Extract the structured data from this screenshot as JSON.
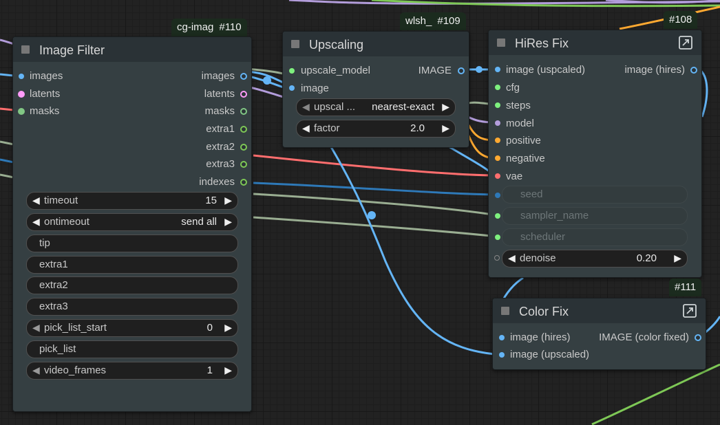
{
  "nodes": {
    "image_filter": {
      "title": "Image Filter",
      "badge_title": "cg-imag",
      "badge_id": "#110",
      "inputs": [
        "images",
        "latents",
        "masks"
      ],
      "outputs": [
        "images",
        "latents",
        "masks",
        "extra1",
        "extra2",
        "extra3",
        "indexes"
      ],
      "widgets": [
        {
          "label": "timeout",
          "value": "15"
        },
        {
          "label": "ontimeout",
          "value": "send all"
        },
        {
          "label": "tip",
          "value": ""
        },
        {
          "label": "extra1",
          "value": ""
        },
        {
          "label": "extra2",
          "value": ""
        },
        {
          "label": "extra3",
          "value": ""
        },
        {
          "label": "pick_list_start",
          "value": "0"
        },
        {
          "label": "pick_list",
          "value": ""
        },
        {
          "label": "video_frames",
          "value": "1"
        }
      ]
    },
    "upscaling": {
      "title": "Upscaling",
      "badge_title": "wlsh_",
      "badge_id": "#109",
      "inputs": [
        "upscale_model",
        "image"
      ],
      "outputs": [
        "IMAGE"
      ],
      "widgets": [
        {
          "label": "upscal ...",
          "value": "nearest-exact"
        },
        {
          "label": "factor",
          "value": "2.0"
        }
      ]
    },
    "hires_fix": {
      "title": "HiRes Fix",
      "badge_id": "#108",
      "inputs": [
        "image (uspcaled)",
        "cfg",
        "steps",
        "model",
        "positive",
        "negative",
        "vae"
      ],
      "outputs": [
        "image (hires)"
      ],
      "converted_widgets": [
        "seed",
        "sampler_name",
        "scheduler"
      ],
      "widgets": [
        {
          "label": "denoise",
          "value": "0.20"
        }
      ]
    },
    "color_fix": {
      "title": "Color Fix",
      "badge_id": "#111",
      "inputs": [
        "image (hires)",
        "image (upscaled)"
      ],
      "outputs": [
        "IMAGE (color fixed)"
      ]
    }
  },
  "colors": {
    "image": "#64b5f6",
    "latent": "#ff9cf9",
    "mask": "#81c784",
    "float": "#aed581",
    "int": "#7ec856",
    "model": "#b39ddb",
    "conditioning": "#ffa931",
    "vae": "#ff6e6e",
    "node_bg": "#353f42",
    "node_header": "#2a3236",
    "badge_bg": "#1b2b1e"
  },
  "icons": {
    "arrow_left": "◀",
    "arrow_right": "▶",
    "expand": "expand-icon",
    "collapse": "collapse-square-icon"
  }
}
